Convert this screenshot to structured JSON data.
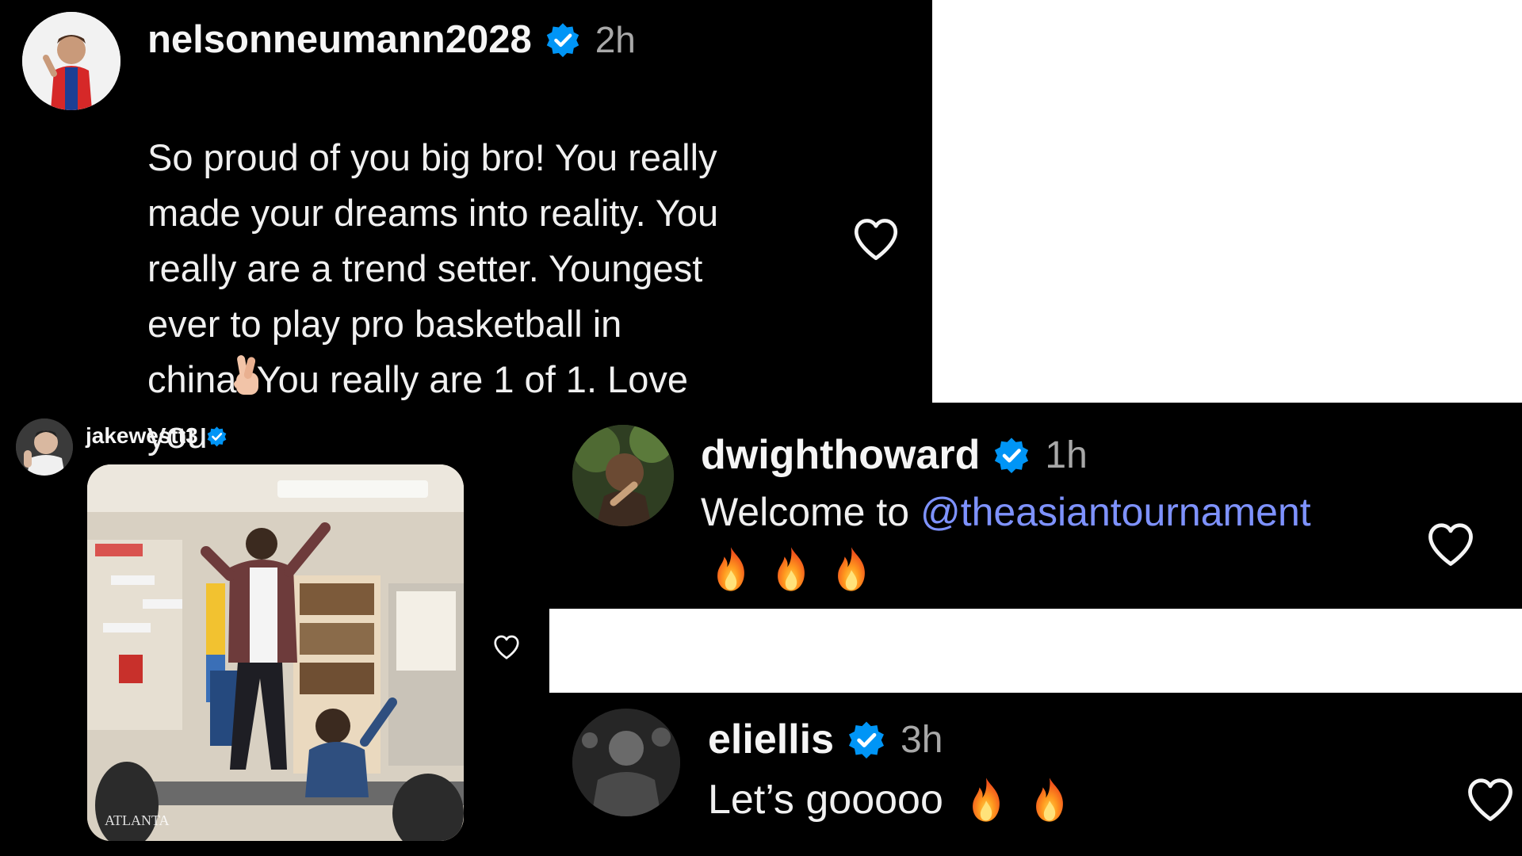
{
  "comments": [
    {
      "username": "nelsonneumann2028",
      "verified": true,
      "time": "2h",
      "text": "So proud of you big bro! You really\nmade your dreams into reality. You\nreally are a trend setter. Youngest\never to play pro basketball in\nchina. You really are 1 of 1. Love\nyou",
      "trailing_emoji": "crossed-fingers-icon"
    },
    {
      "username": "jakewestt3",
      "verified": true,
      "attachment": "classroom-gif",
      "gif_watermark": "ATLANTA"
    },
    {
      "username": "dwighthoward",
      "verified": true,
      "time": "1h",
      "text_prefix": "Welcome to ",
      "mention": "@theasiantournament",
      "emoji_row": [
        "fire-icon",
        "fire-icon",
        "fire-icon"
      ]
    },
    {
      "username": "eliellis",
      "verified": true,
      "time": "3h",
      "text": "Let’s gooooo",
      "emoji_row": [
        "fire-icon",
        "fire-icon"
      ]
    }
  ],
  "colors": {
    "background": "#000000",
    "verified_badge": "#0095f6",
    "mention": "#7e92ff",
    "time": "#a8a8a8",
    "text": "#f5f5f5"
  }
}
